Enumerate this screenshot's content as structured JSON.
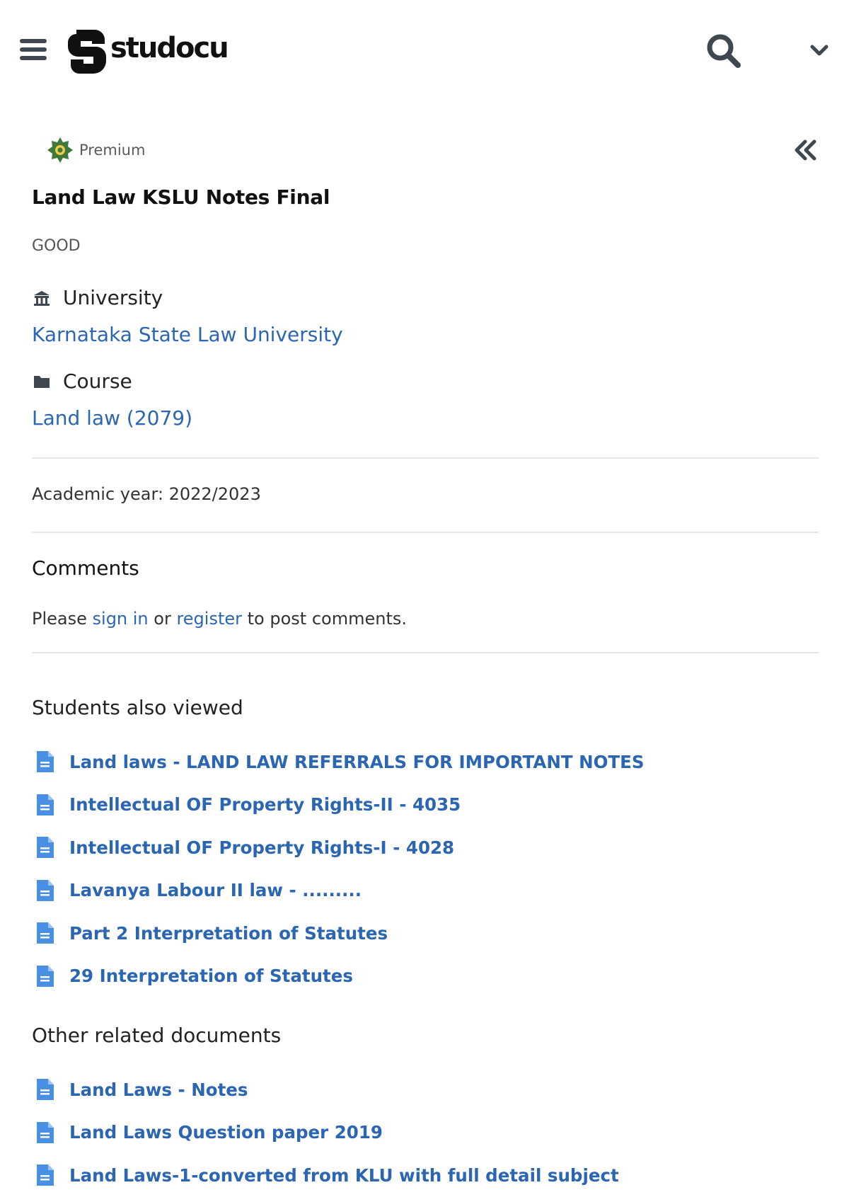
{
  "header": {
    "logo_text": "studocu",
    "icons": [
      "menu-icon",
      "studocu-logo",
      "search-icon",
      "chevron-down-icon"
    ]
  },
  "document": {
    "badge": "Premium",
    "title": "Land Law KSLU Notes Final",
    "description": "GOOD",
    "university_label": "University",
    "university": "Karnataka State Law University",
    "course_label": "Course",
    "course": "Land law (2079)",
    "academic_year": "Academic year: 2022/2023"
  },
  "comments": {
    "title": "Comments",
    "prefix": "Please ",
    "sign_in": "sign in",
    "middle": " or ",
    "register": "register",
    "suffix": " to post comments."
  },
  "students_also_viewed": {
    "title": "Students also viewed",
    "items": [
      "Land laws - LAND LAW REFERRALS FOR IMPORTANT NOTES",
      "Intellectual OF Property Rights-II - 4035",
      "Intellectual OF Property Rights-I - 4028",
      "Lavanya Labour II law - .........",
      "Part 2 Interpretation of Statutes",
      "29 Interpretation of Statutes"
    ]
  },
  "other_related": {
    "title": "Other related documents",
    "items": [
      "Land Laws - Notes",
      "Land Laws Question paper 2019",
      "Land Laws-1-converted from KLU with full detail subject"
    ]
  },
  "colors": {
    "link": "#2a66b2",
    "premium_badge": "#3d7a3a",
    "doc_icon": "#4a90e2"
  }
}
